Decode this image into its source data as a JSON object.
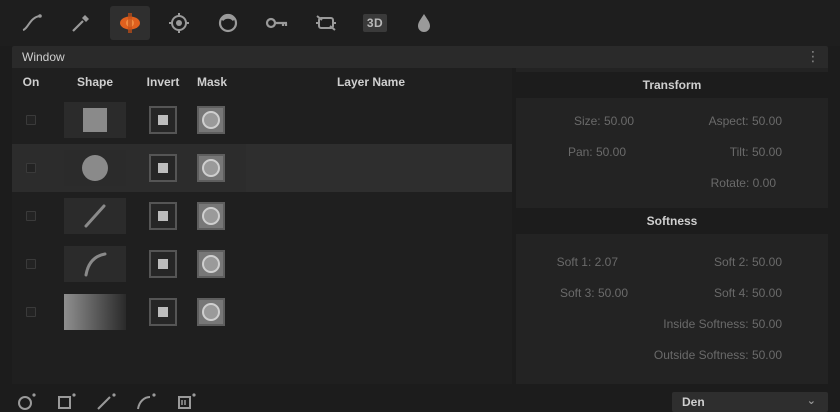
{
  "toolbar": {
    "tools": [
      {
        "icon": "curve-icon"
      },
      {
        "icon": "picker-icon"
      },
      {
        "icon": "power-window-icon",
        "active": true
      },
      {
        "icon": "tracker-icon"
      },
      {
        "icon": "magic-mask-icon"
      },
      {
        "icon": "key-icon"
      },
      {
        "icon": "resize-icon"
      },
      {
        "icon": "3d-icon",
        "label": "3D"
      },
      {
        "icon": "blur-icon"
      }
    ],
    "accent": "#e0601e"
  },
  "window": {
    "title": "Window"
  },
  "layers": {
    "columns": {
      "on": "On",
      "shape": "Shape",
      "invert": "Invert",
      "mask": "Mask",
      "name": "Layer Name"
    },
    "rows": [
      {
        "shape": "square-shape-icon",
        "highlighted": false
      },
      {
        "shape": "circle-shape-icon",
        "highlighted": true
      },
      {
        "shape": "line-shape-icon",
        "highlighted": false
      },
      {
        "shape": "curve-shape-icon",
        "highlighted": false
      },
      {
        "shape": "gradient-shape-icon",
        "highlighted": false
      }
    ]
  },
  "transform": {
    "title": "Transform",
    "size": "Size: 50.00",
    "aspect": "Aspect: 50.00",
    "pan": "Pan: 50.00",
    "tilt": "Tilt: 50.00",
    "rotate": "Rotate: 0.00"
  },
  "softness": {
    "title": "Softness",
    "soft1": "Soft 1: 2.07",
    "soft2": "Soft 2: 50.00",
    "soft3": "Soft 3: 50.00",
    "soft4": "Soft 4: 50.00",
    "inside": "Inside Softness: 50.00",
    "outside": "Outside Softness: 50.00"
  },
  "bottom": {
    "tools": [
      {
        "icon": "add-circle-icon"
      },
      {
        "icon": "add-square-icon"
      },
      {
        "icon": "add-line-icon"
      },
      {
        "icon": "add-curve-icon"
      },
      {
        "icon": "add-gradient-icon"
      }
    ],
    "dropdown_value": "Den"
  }
}
